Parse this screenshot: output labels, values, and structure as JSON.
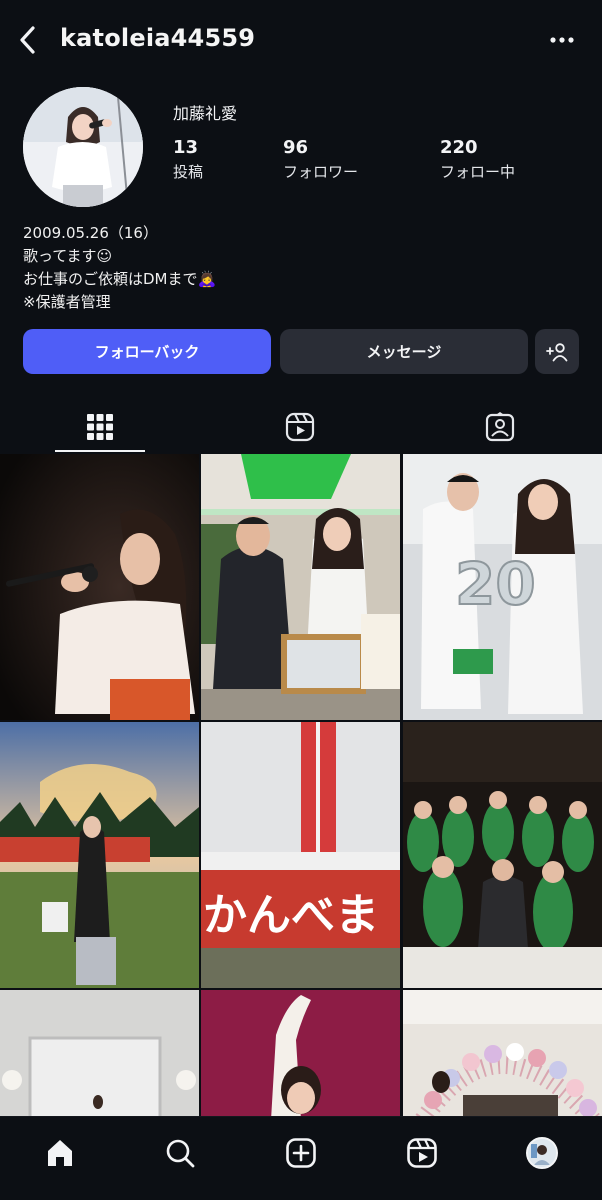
{
  "header": {
    "username": "katoleia44559",
    "back_icon": "chevron-left-icon",
    "more_icon": "more-horizontal-icon"
  },
  "profile": {
    "display_name": "加藤礼愛",
    "stats": [
      {
        "value": "13",
        "label": "投稿"
      },
      {
        "value": "96",
        "label": "フォロワー"
      },
      {
        "value": "220",
        "label": "フォロー中"
      }
    ],
    "bio": [
      "2009.05.26（16）",
      "歌ってます☺",
      "お仕事のご依頼はDMまで🙇‍♀️",
      "※保護者管理"
    ]
  },
  "actions": {
    "follow_back": "フォローバック",
    "message": "メッセージ",
    "add_user_icon": "add-user-icon"
  },
  "tabs": [
    {
      "icon": "grid-icon",
      "active": true
    },
    {
      "icon": "reels-icon",
      "active": false
    },
    {
      "icon": "tagged-icon",
      "active": false
    }
  ],
  "grid": {
    "posts": [
      {
        "subject": "singer-on-stage"
      },
      {
        "subject": "handshake-at-tent"
      },
      {
        "subject": "anniversary-balloons-20"
      },
      {
        "subject": "sunset-field"
      },
      {
        "subject": "kanbe-festival-stage"
      },
      {
        "subject": "group-photo-venue"
      },
      {
        "subject": "indoor-hall"
      },
      {
        "subject": "dancer-pink-background"
      },
      {
        "subject": "balloon-arch"
      }
    ],
    "sign_texts": {
      "festival_banner": "かんべま",
      "balloon_number": "20"
    }
  },
  "navbar": [
    {
      "icon": "home-icon",
      "active": true
    },
    {
      "icon": "search-icon",
      "active": false
    },
    {
      "icon": "create-post-icon",
      "active": false
    },
    {
      "icon": "reels-icon",
      "active": false
    },
    {
      "icon": "profile-avatar-icon",
      "active": false
    }
  ],
  "colors": {
    "background": "#0c0f14",
    "primary_button": "#4f5ef7",
    "secondary_button": "#2a2d36",
    "text": "#f3f4f6"
  }
}
